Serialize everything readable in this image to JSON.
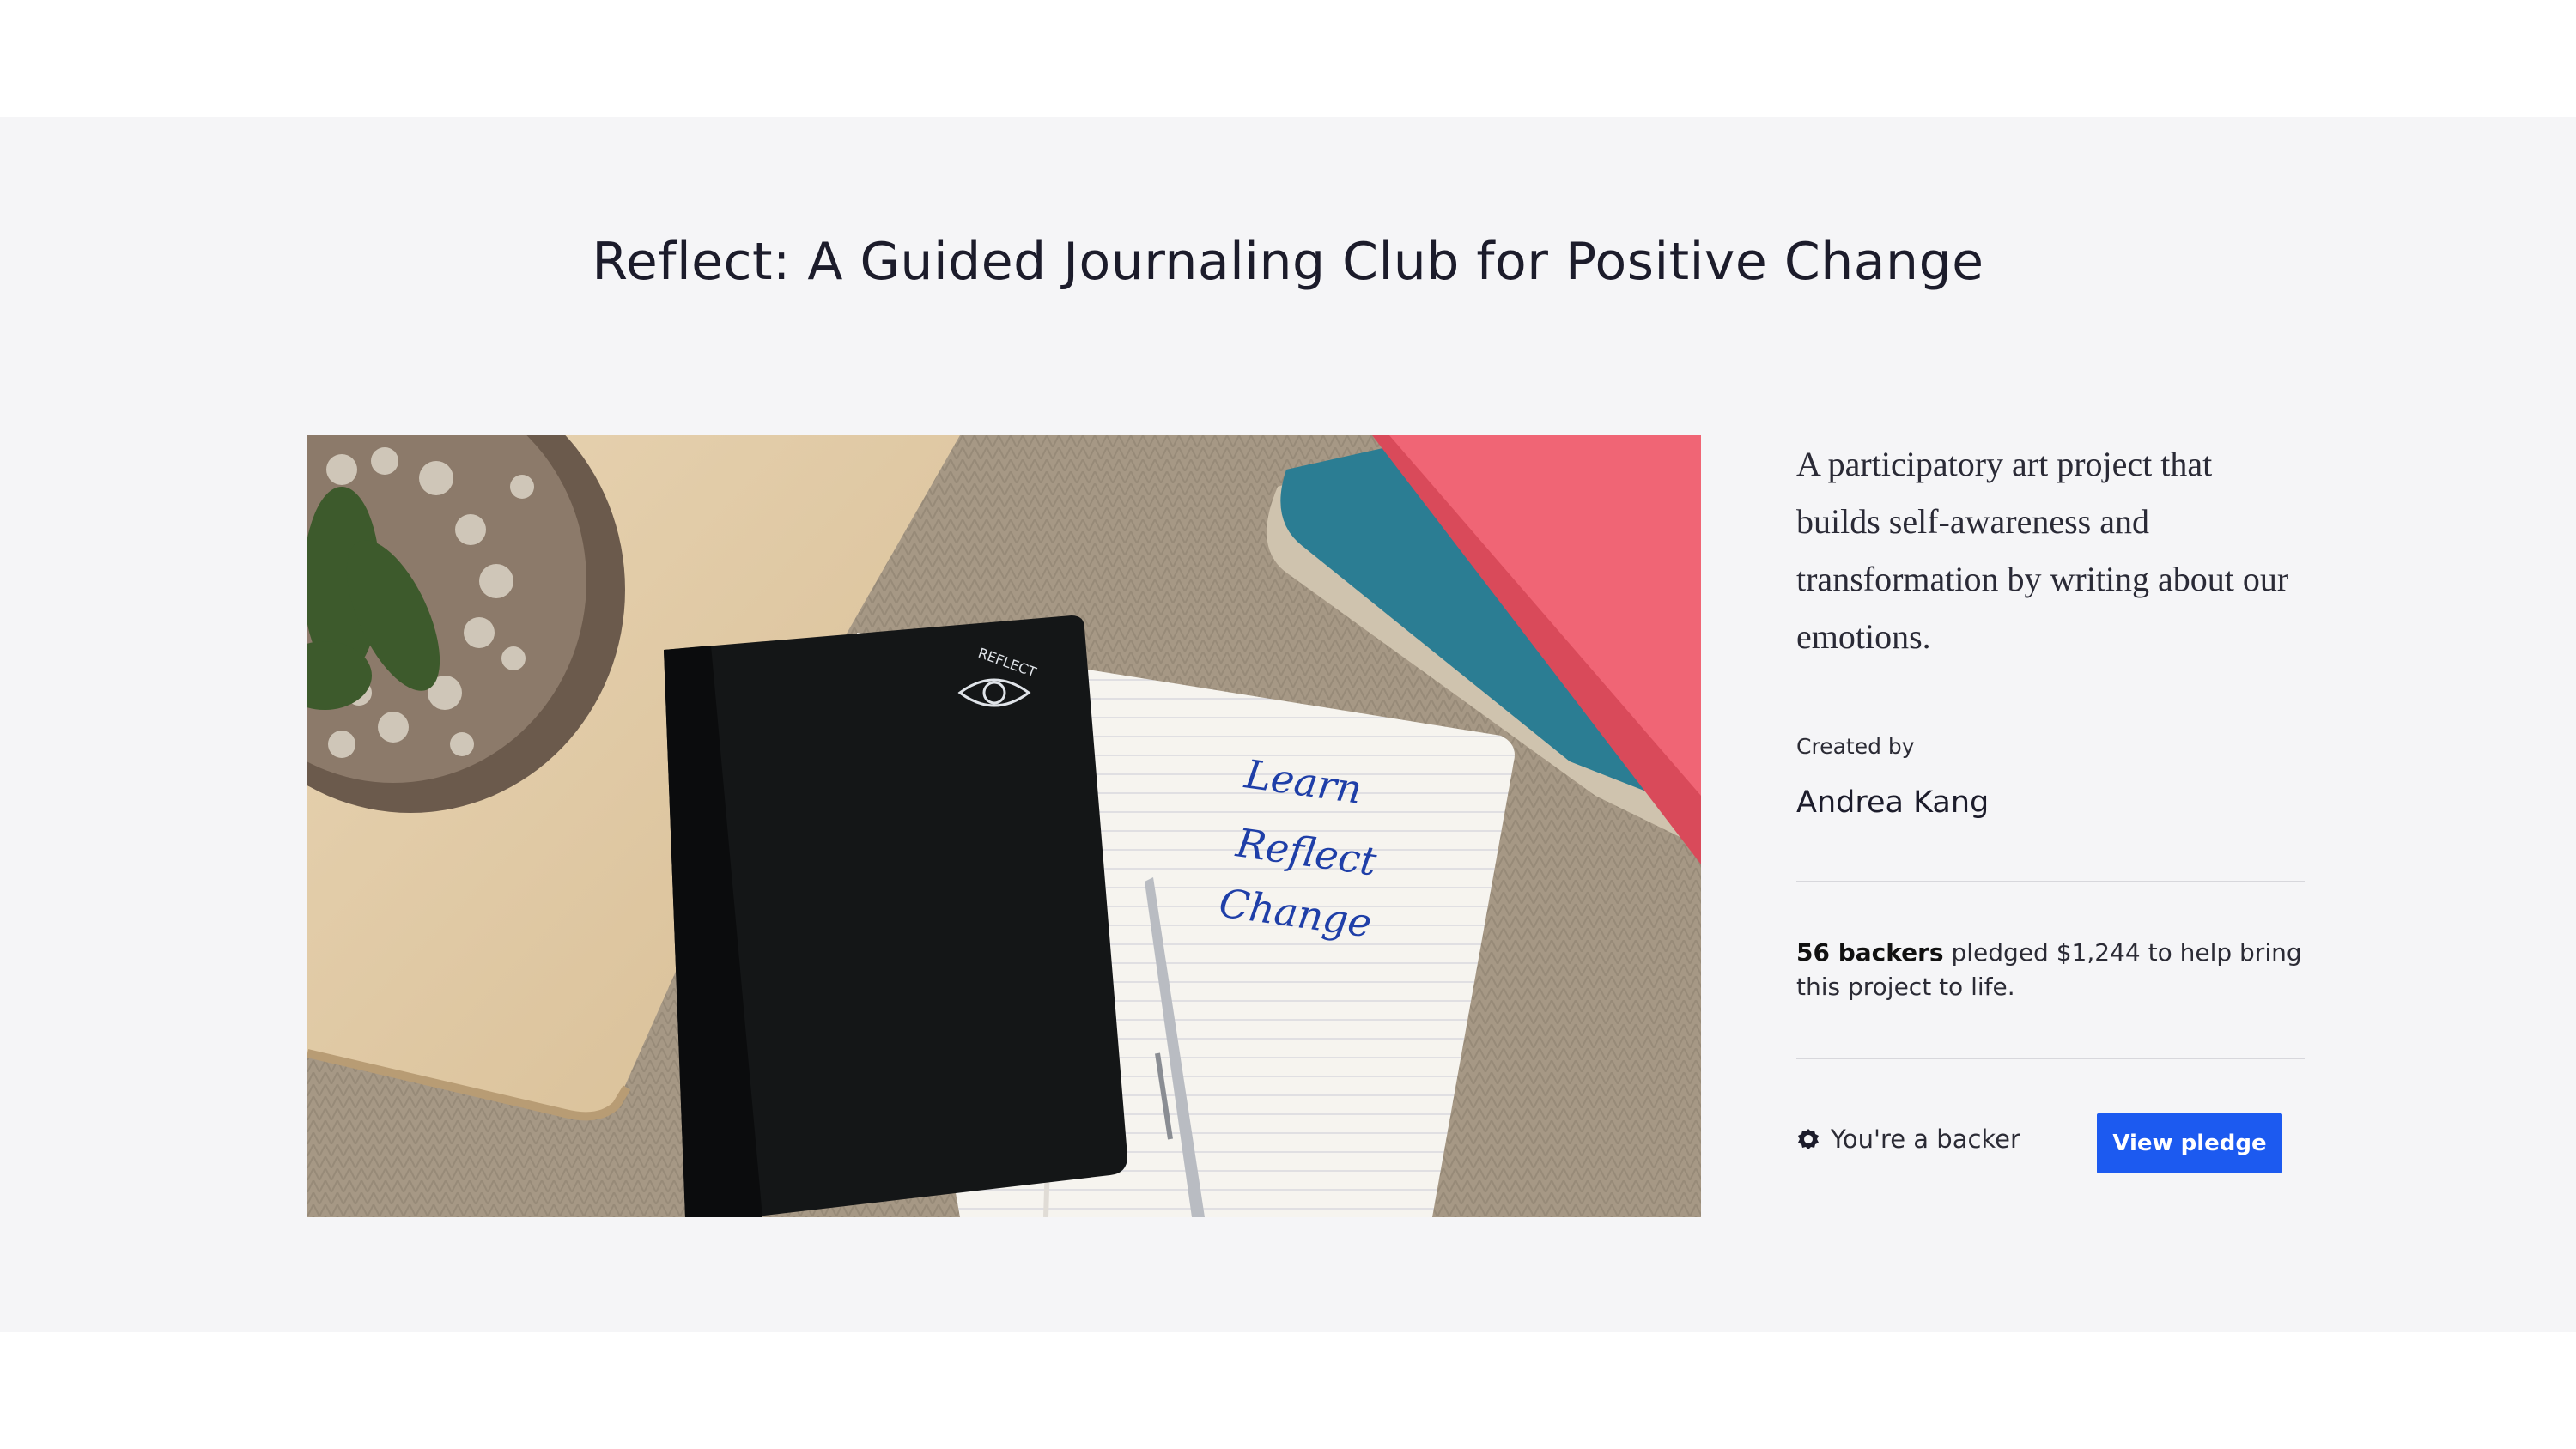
{
  "project": {
    "title": "Reflect: A Guided Journaling Club for Positive Change",
    "blurb": "A participatory art project that builds self-awareness and transformation by writing about our emotions.",
    "created_by_label": "Created by",
    "creator": "Andrea Kang",
    "backers_count": "56 backers",
    "funding_text": " pledged $1,244 to help bring this project to life.",
    "backer_status": "You're a backer",
    "view_pledge_label": "View pledge"
  },
  "hero_image": {
    "notebook_logo_text": "REFLECT",
    "handwritten_lines": [
      "Learn",
      "Reflect",
      "Change"
    ]
  },
  "colors": {
    "accent": "#1c5af0",
    "band": "#f5f5f7"
  },
  "icons": [
    "gear-icon"
  ]
}
